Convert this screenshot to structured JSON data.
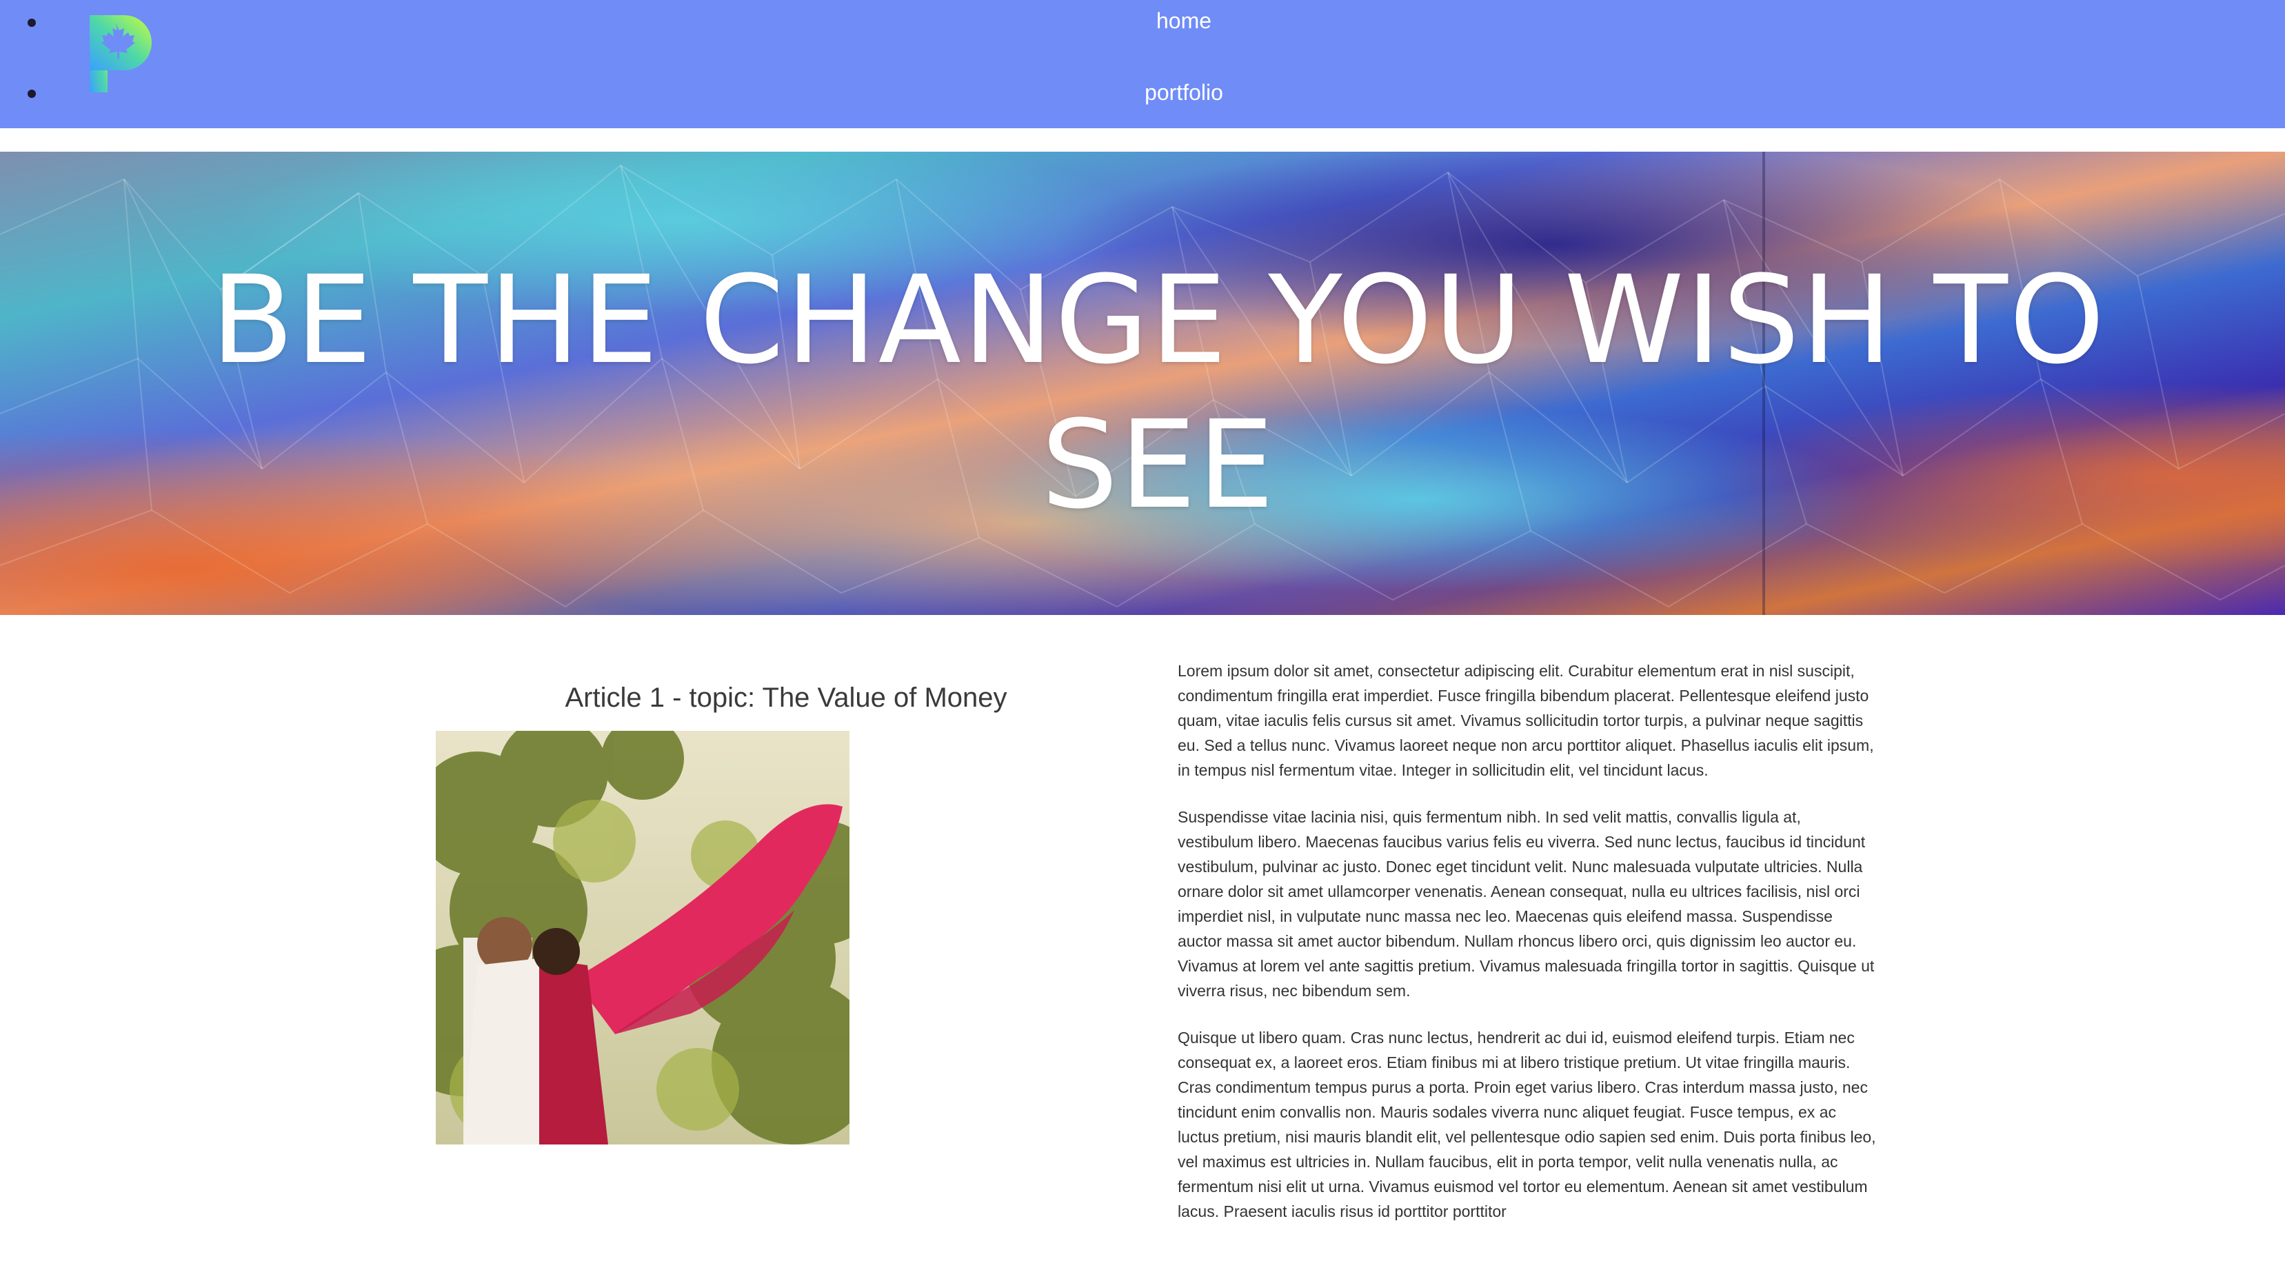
{
  "nav": {
    "items": [
      {
        "label": "home"
      },
      {
        "label": "portfolio"
      }
    ],
    "logo_icon": "maple-leaf-p-logo",
    "background": "#6f8cf7"
  },
  "hero": {
    "title": "BE THE CHANGE YOU WISH TO SEE"
  },
  "article": {
    "title": "Article 1 - topic: The Value of Money",
    "paragraphs": [
      "Lorem ipsum dolor sit amet, consectetur adipiscing elit. Curabitur elementum erat in nisl suscipit, condimentum fringilla erat imperdiet. Fusce fringilla bibendum placerat. Pellentesque eleifend justo quam, vitae iaculis felis cursus sit amet. Vivamus sollicitudin tortor turpis, a pulvinar neque sagittis eu. Sed a tellus nunc. Vivamus laoreet neque non arcu porttitor aliquet. Phasellus iaculis elit ipsum, in tempus nisl fermentum vitae. Integer in sollicitudin elit, vel tincidunt lacus.",
      "Suspendisse vitae lacinia nisi, quis fermentum nibh. In sed velit mattis, convallis ligula at, vestibulum libero. Maecenas faucibus varius felis eu viverra. Sed nunc lectus, faucibus id tincidunt vestibulum, pulvinar ac justo. Donec eget tincidunt velit. Nunc malesuada vulputate ultricies. Nulla ornare dolor sit amet ullamcorper venenatis. Aenean consequat, nulla eu ultrices facilisis, nisl orci imperdiet nisl, in vulputate nunc massa nec leo. Maecenas quis eleifend massa. Suspendisse auctor massa sit amet auctor bibendum. Nullam rhoncus libero orci, quis dignissim leo auctor eu. Vivamus at lorem vel ante sagittis pretium. Vivamus malesuada fringilla tortor in sagittis. Quisque ut viverra risus, nec bibendum sem.",
      "Quisque ut libero quam. Cras nunc lectus, hendrerit ac dui id, euismod eleifend turpis. Etiam nec consequat ex, a laoreet eros. Etiam finibus mi at libero tristique pretium. Ut vitae fringilla mauris. Cras condimentum tempus purus a porta. Proin eget varius libero. Cras interdum massa justo, nec tincidunt enim convallis non. Mauris sodales viverra nunc aliquet feugiat. Fusce tempus, ex ac luctus pretium, nisi mauris blandit elit, vel pellentesque odio sapien sed enim. Duis porta finibus leo, vel maximus est ultricies in. Nullam faucibus, elit in porta tempor, velit nulla venenatis nulla, ac fermentum nisi elit ut urna. Vivamus euismod vel tortor eu elementum. Aenean sit amet vestibulum lacus. Praesent iaculis risus id porttitor porttitor"
    ]
  }
}
